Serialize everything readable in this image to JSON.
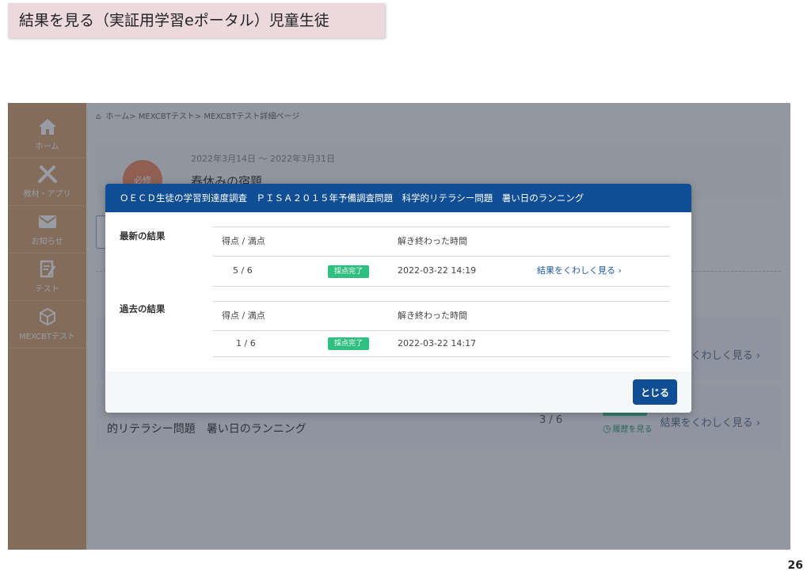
{
  "slide": {
    "title": "結果を見る（実証用学習eポータル）児童生徒",
    "page_number": "26"
  },
  "sidebar": {
    "items": [
      {
        "label": "ホーム",
        "icon": "home-icon"
      },
      {
        "label": "教材・アプリ",
        "icon": "tools-icon"
      },
      {
        "label": "お知らせ",
        "icon": "mail-icon"
      },
      {
        "label": "テスト",
        "icon": "test-icon"
      },
      {
        "label": "MEXCBTテスト",
        "icon": "cube-icon"
      }
    ]
  },
  "breadcrumb": {
    "home_icon": "⌂",
    "text": "ホーム> MEXCBTテスト> MEXCBTテスト詳細ページ"
  },
  "card": {
    "badge": "必修",
    "date_range": "2022年3月14日 ～ 2022年3月31日",
    "title": "春休みの宿題"
  },
  "rows": [
    {
      "link": "結果をくわしく見る ›"
    },
    {
      "name": "的リテラシー問題　暑い日のランニング",
      "score": "3 / 6",
      "history": "履歴を見る",
      "link": "結果をくわしく見る ›"
    }
  ],
  "modal": {
    "title": "ＯＥＣＤ生徒の学習到達度調査　ＰＩＳＡ２０１５年予備調査問題　科学的リテラシー問題　暑い日のランニング",
    "latest_label": "最新の結果",
    "past_label": "過去の結果",
    "col_score": "得点 / 満点",
    "col_time": "解き終わった時間",
    "latest": {
      "score": "5 / 6",
      "status": "採点完了",
      "time": "2022-03-22 14:19",
      "link": "結果をくわしく見る ›"
    },
    "past": {
      "score": "1 / 6",
      "status": "採点完了",
      "time": "2022-03-22 14:17"
    },
    "close_label": "とじる"
  },
  "colors": {
    "sidebar": "#d8a474",
    "modal_header": "#0f4d94",
    "status_green": "#2fbf7f",
    "required_badge": "#f08a63"
  }
}
